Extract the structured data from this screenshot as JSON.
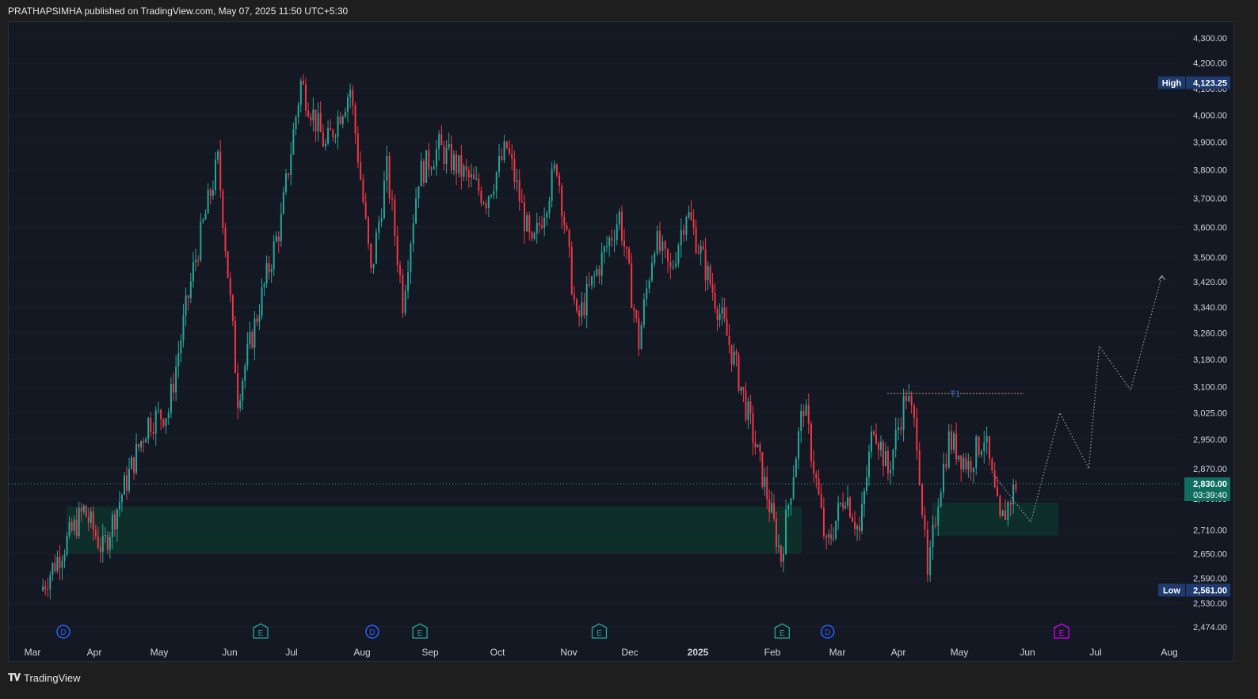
{
  "header": {
    "text": "PRATHAPSIMHA published on TradingView.com, May 07, 2025 11:50 UTC+5:30"
  },
  "footer": {
    "logo_icon": "tradingview-logo-icon",
    "brand": "TradingView"
  },
  "colors": {
    "up": "#26a69a",
    "down": "#f23645",
    "zone": "#0d2f2a",
    "badge": "#1e3a6e",
    "price_badge": "#0f6e5f",
    "dots": "#9aa0ad"
  },
  "chart_data": {
    "type": "candlestick",
    "price_axis": {
      "ticks": [
        "4,300.00",
        "4,200.00",
        "4,100.00",
        "4,000.00",
        "3,900.00",
        "3,800.00",
        "3,700.00",
        "3,600.00",
        "3,500.00",
        "3,420.00",
        "3,340.00",
        "3,260.00",
        "3,180.00",
        "3,100.00",
        "3,025.00",
        "2,950.00",
        "2,870.00",
        "2,790.00",
        "2,710.00",
        "2,650.00",
        "2,590.00",
        "2,530.00",
        "2,474.00"
      ],
      "scale": "log"
    },
    "time_axis": {
      "ticks": [
        "Mar",
        "Apr",
        "May",
        "Jun",
        "Jul",
        "Aug",
        "Sep",
        "Oct",
        "Nov",
        "Dec",
        "2025",
        "Feb",
        "Mar",
        "Apr",
        "May",
        "Jun",
        "Jul",
        "Aug"
      ]
    },
    "high": {
      "label": "High",
      "value": "4,123.25"
    },
    "low": {
      "label": "Low",
      "value": "2,561.00"
    },
    "last_price": {
      "value": "2,830.00",
      "countdown": "03:39:40"
    },
    "target": {
      "label": "T1",
      "value": 3080
    },
    "demand_zones": [
      {
        "from_month": "Mar 2024",
        "to_month": "Feb 2025",
        "low": 2650,
        "high": 2770
      },
      {
        "from_month": "Apr 2025",
        "to_month": "Jun 2025",
        "low": 2695,
        "high": 2780
      }
    ],
    "projection_path": [
      {
        "t": "May 2025",
        "price": 2860
      },
      {
        "t": "Jun 2025",
        "price": 2730
      },
      {
        "t": "Jun 2025",
        "price": 3025
      },
      {
        "t": "Jun 2025",
        "price": 2870
      },
      {
        "t": "Jul 2025",
        "price": 3220
      },
      {
        "t": "Jul 2025",
        "price": 3090
      },
      {
        "t": "Jul 2025",
        "price": 3440
      }
    ],
    "events": [
      {
        "type": "D",
        "t": "Mar 2024"
      },
      {
        "type": "E",
        "t": "Jun 2024"
      },
      {
        "type": "D",
        "t": "Aug 2024"
      },
      {
        "type": "E",
        "t": "Aug 2024"
      },
      {
        "type": "E",
        "t": "Nov 2024"
      },
      {
        "type": "E",
        "t": "Feb 2025"
      },
      {
        "type": "D",
        "t": "Feb 2025"
      },
      {
        "type": "E",
        "t": "Jun 2025"
      }
    ],
    "swings": [
      {
        "t": "Mar 2024",
        "price": 2560
      },
      {
        "t": "Mar 2024",
        "price": 2760
      },
      {
        "t": "Apr 2024",
        "price": 2660
      },
      {
        "t": "Apr 2024",
        "price": 3000
      },
      {
        "t": "May 2024",
        "price": 3030
      },
      {
        "t": "May 2024",
        "price": 3460
      },
      {
        "t": "May 2024",
        "price": 3830
      },
      {
        "t": "Jun 2024",
        "price": 3070
      },
      {
        "t": "Jun 2024",
        "price": 3620
      },
      {
        "t": "Jul 2024",
        "price": 4123
      },
      {
        "t": "Jul 2024",
        "price": 3880
      },
      {
        "t": "Jul 2024",
        "price": 4100
      },
      {
        "t": "Aug 2024",
        "price": 3440
      },
      {
        "t": "Aug 2024",
        "price": 3800
      },
      {
        "t": "Aug 2024",
        "price": 3360
      },
      {
        "t": "Aug 2024",
        "price": 3780
      },
      {
        "t": "Sep 2024",
        "price": 3880
      },
      {
        "t": "Sep 2024",
        "price": 3700
      },
      {
        "t": "Oct 2024",
        "price": 3880
      },
      {
        "t": "Oct 2024",
        "price": 3520
      },
      {
        "t": "Oct 2024",
        "price": 3820
      },
      {
        "t": "Nov 2024",
        "price": 3290
      },
      {
        "t": "Nov 2024",
        "price": 3640
      },
      {
        "t": "Dec 2024",
        "price": 3230
      },
      {
        "t": "Dec 2024",
        "price": 3560
      },
      {
        "t": "Dec 2024",
        "price": 3450
      },
      {
        "t": "Dec 2024",
        "price": 3660
      },
      {
        "t": "Jan 2025",
        "price": 3440
      },
      {
        "t": "Jan 2025",
        "price": 3180
      },
      {
        "t": "Jan 2025",
        "price": 2880
      },
      {
        "t": "Feb 2025",
        "price": 2640
      },
      {
        "t": "Feb 2025",
        "price": 3050
      },
      {
        "t": "Feb 2025",
        "price": 2660
      },
      {
        "t": "Mar 2025",
        "price": 2810
      },
      {
        "t": "Mar 2025",
        "price": 2700
      },
      {
        "t": "Mar 2025",
        "price": 3000
      },
      {
        "t": "Mar 2025",
        "price": 2860
      },
      {
        "t": "Apr 2025",
        "price": 3080
      },
      {
        "t": "Apr 2025",
        "price": 2960
      },
      {
        "t": "Apr 2025",
        "price": 2580
      },
      {
        "t": "Apr 2025",
        "price": 2800
      },
      {
        "t": "Apr 2025",
        "price": 2950
      },
      {
        "t": "May 2025",
        "price": 2880
      },
      {
        "t": "May 2025",
        "price": 2960
      },
      {
        "t": "May 2025",
        "price": 2720
      },
      {
        "t": "May 2025",
        "price": 2830
      }
    ]
  }
}
